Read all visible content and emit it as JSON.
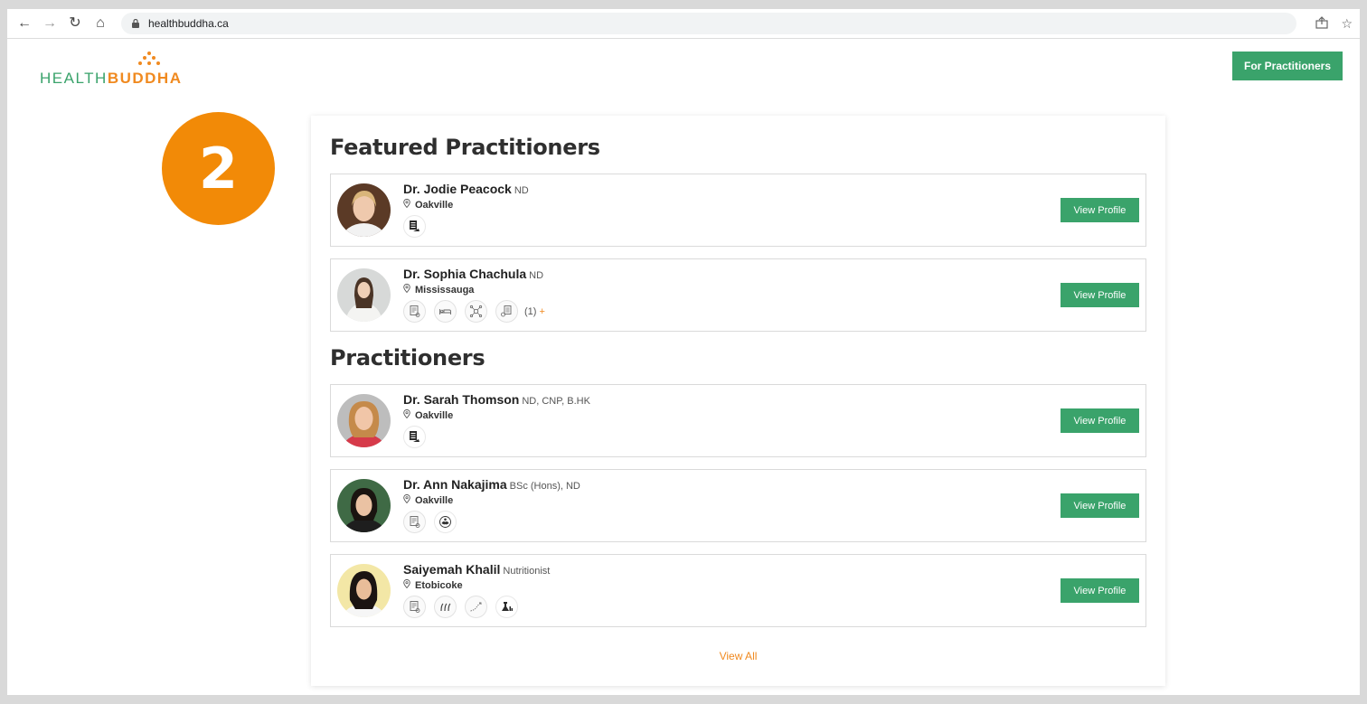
{
  "browser": {
    "url": "healthbuddha.ca"
  },
  "header": {
    "logo_health": "HEALTH",
    "logo_buddha": "BUDDHA",
    "for_practitioners_label": "For Practitioners",
    "brand_green": "#3aa36b",
    "brand_orange": "#f08a20"
  },
  "step_badge": "2",
  "featured": {
    "title": "Featured Practitioners",
    "items": [
      {
        "name": "Dr. Jodie Peacock",
        "credentials": "ND",
        "location": "Oakville",
        "icons": [
          "clinic-list-icon"
        ],
        "button": "View Profile"
      },
      {
        "name": "Dr. Sophia Chachula",
        "credentials": "ND",
        "location": "Mississauga",
        "icons": [
          "prescription-icon",
          "bed-icon",
          "network-icon",
          "clinic-list-icon"
        ],
        "more_count": "(1)",
        "more_plus": "+",
        "button": "View Profile"
      }
    ]
  },
  "practitioners": {
    "title": "Practitioners",
    "items": [
      {
        "name": "Dr. Sarah Thomson",
        "credentials": "ND, CNP, B.HK",
        "location": "Oakville",
        "icons": [
          "clinic-list-icon"
        ],
        "button": "View Profile"
      },
      {
        "name": "Dr. Ann Nakajima",
        "credentials": "BSc (Hons), ND",
        "location": "Oakville",
        "icons": [
          "prescription-icon",
          "hands-icon"
        ],
        "button": "View Profile"
      },
      {
        "name": "Saiyemah Khalil",
        "credentials": "Nutritionist",
        "location": "Etobicoke",
        "icons": [
          "prescription-icon",
          "leaves-icon",
          "growth-icon",
          "lab-icon"
        ],
        "button": "View Profile"
      }
    ]
  },
  "view_all_label": "View All"
}
